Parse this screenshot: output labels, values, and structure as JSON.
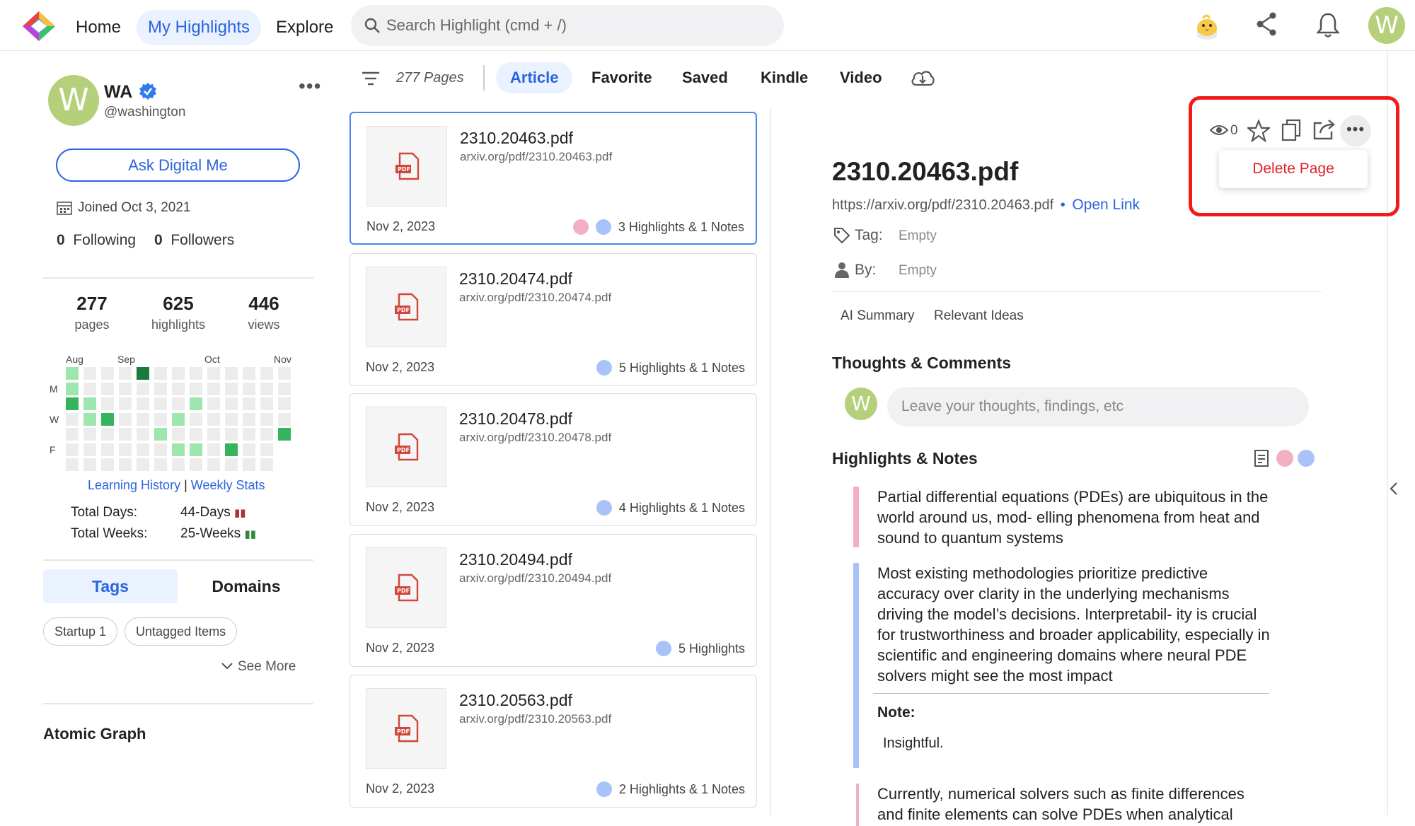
{
  "nav": {
    "home": "Home",
    "my_highlights": "My Highlights",
    "explore": "Explore",
    "search_placeholder": "Search Highlight (cmd + /)",
    "avatar_letter": "W"
  },
  "profile": {
    "avatar_letter": "W",
    "name": "WA",
    "handle": "@washington",
    "ask_button": "Ask Digital Me",
    "joined": "Joined Oct 3, 2021",
    "following_count": "0",
    "following_label": "Following",
    "followers_count": "0",
    "followers_label": "Followers",
    "stats": [
      {
        "num": "277",
        "label": "pages"
      },
      {
        "num": "625",
        "label": "highlights"
      },
      {
        "num": "446",
        "label": "views"
      }
    ]
  },
  "heatmap": {
    "months": [
      "Aug",
      "Sep",
      "Oct",
      "Nov"
    ],
    "days": [
      "M",
      "W",
      "F"
    ],
    "links": {
      "history": "Learning History",
      "divider": "|",
      "weekly": "Weekly Stats"
    },
    "total_days_label": "Total Days:",
    "total_days_value": "44-Days",
    "total_weeks_label": "Total Weeks:",
    "total_weeks_value": "25-Weeks"
  },
  "tags": {
    "tab_tags": "Tags",
    "tab_domains": "Domains",
    "chips": [
      "Startup 1",
      "Untagged Items"
    ],
    "see_more": "See More"
  },
  "atomic_graph": "Atomic Graph",
  "list": {
    "page_count": "277 Pages",
    "filters": [
      "Article",
      "Favorite",
      "Saved",
      "Kindle",
      "Video"
    ],
    "cards": [
      {
        "title": "2310.20463.pdf",
        "url": "arxiv.org/pdf/2310.20463.pdf",
        "date": "Nov 2, 2023",
        "meta": "3 Highlights & 1 Notes",
        "dots": [
          "#f4b0c3",
          "#a9c2f7"
        ]
      },
      {
        "title": "2310.20474.pdf",
        "url": "arxiv.org/pdf/2310.20474.pdf",
        "date": "Nov 2, 2023",
        "meta": "5 Highlights & 1 Notes",
        "dots": [
          "#a9c2f7"
        ]
      },
      {
        "title": "2310.20478.pdf",
        "url": "arxiv.org/pdf/2310.20478.pdf",
        "date": "Nov 2, 2023",
        "meta": "4 Highlights & 1 Notes",
        "dots": [
          "#a9c2f7"
        ]
      },
      {
        "title": "2310.20494.pdf",
        "url": "arxiv.org/pdf/2310.20494.pdf",
        "date": "Nov 2, 2023",
        "meta": "5 Highlights",
        "dots": [
          "#a9c2f7"
        ]
      },
      {
        "title": "2310.20563.pdf",
        "url": "arxiv.org/pdf/2310.20563.pdf",
        "date": "Nov 2, 2023",
        "meta": "2 Highlights & 1 Notes",
        "dots": [
          "#a9c2f7"
        ]
      }
    ]
  },
  "detail": {
    "views": "0",
    "delete_page": "Delete Page",
    "title": "2310.20463.pdf",
    "url": "https://arxiv.org/pdf/2310.20463.pdf",
    "url_sep": "•",
    "open_link": "Open Link",
    "tag_label": "Tag:",
    "tag_value": "Empty",
    "by_label": "By:",
    "by_value": "Empty",
    "sub_tabs": [
      "AI Summary",
      "Relevant Ideas"
    ],
    "thoughts_title": "Thoughts & Comments",
    "thoughts_avatar": "W",
    "thoughts_placeholder": "Leave your thoughts, findings, etc",
    "highlights_title": "Highlights & Notes",
    "highlights": [
      "Partial differential equations (PDEs) are ubiquitous in the world around us, mod- elling phenomena from heat and sound to quantum systems",
      "Most existing methodologies prioritize predictive accuracy over clarity in the underlying mechanisms driving the model’s decisions. Interpretabil- ity is crucial for trustworthiness and broader applicability, especially in scientific and engineering domains where neural PDE solvers might see the most impact",
      "Currently, numerical solvers such as finite differences and finite elements can solve PDEs when analytical"
    ],
    "note_label": "Note:",
    "note_text": "Insightful."
  },
  "colors": {
    "accent": "#2b64de",
    "pink": "#f4b0c3",
    "blue": "#a9c2f7",
    "highlight_box": "#f21b1b"
  }
}
